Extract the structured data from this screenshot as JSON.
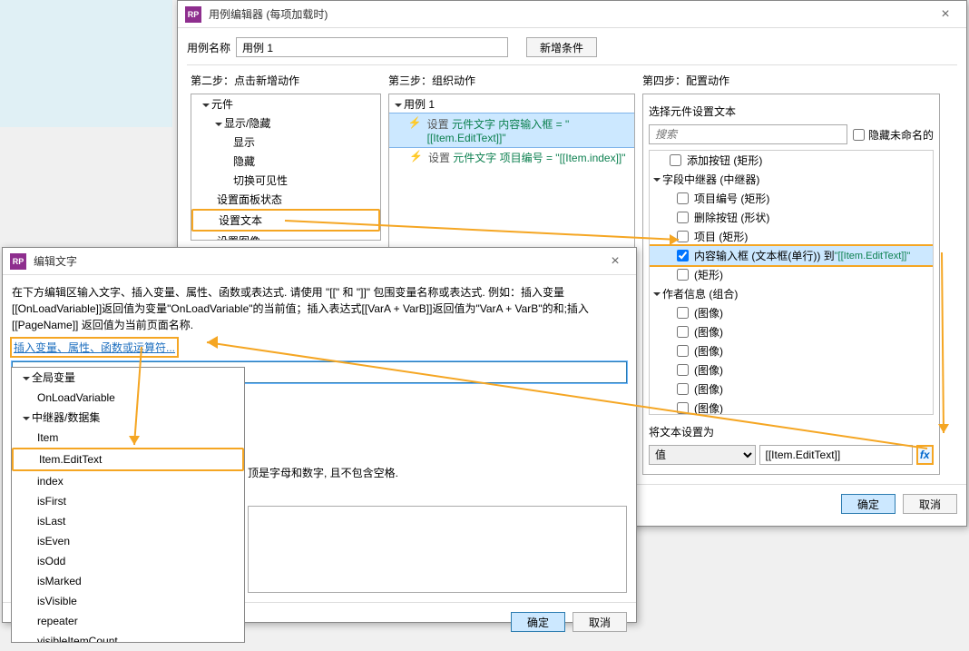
{
  "bgHint": "",
  "caseEditor": {
    "title": "用例编辑器 (每项加载时)",
    "caseNameLabel": "用例名称",
    "caseNameValue": "用例 1",
    "addConditionBtn": "新增条件",
    "step2Title": "第二步：点击新增动作",
    "step3Title": "第三步：组织动作",
    "step4Title": "第四步：配置动作",
    "actionsTree": {
      "g0": "元件",
      "g0_0": "显示/隐藏",
      "g0_0_0": "显示",
      "g0_0_1": "隐藏",
      "g0_0_2": "切换可见性",
      "g0_1": "设置面板状态",
      "g0_2": "设置文本",
      "g0_3": "设置图像"
    },
    "step3": {
      "caseHead": "用例 1",
      "a1_prefix": "设置 ",
      "a1_link": "元件文字 内容输入框 = \"[[Item.EditText]]\"",
      "a2_prefix": "设置 ",
      "a2_link": "元件文字 项目编号 = \"[[Item.index]]\""
    },
    "step4": {
      "selectHead": "选择元件设置文本",
      "searchPlaceholder": "搜索",
      "hideUnnamed": "隐藏未命名的",
      "items": {
        "addBtn": "添加按钮 (矩形)",
        "repeater": "字段中继器 (中继器)",
        "field0": "项目编号 (矩形)",
        "field1": "删除按钮 (形状)",
        "field2": "项目 (矩形)",
        "field3_a": "内容输入框 (文本框(单行)) 到 ",
        "field3_b": "\"[[Item.EditText]]\"",
        "field4": "(矩形)",
        "authorGroup": "作者信息 (组合)",
        "img": "(图像)"
      },
      "setTextAs": "将文本设置为",
      "setTextMode": "值",
      "setTextValue": "[[Item.EditText]]",
      "fxLabel": "fx"
    },
    "okBtn": "确定",
    "cancelBtn": "取消"
  },
  "editText": {
    "title": "编辑文字",
    "instructions": "在下方编辑区输入文字、插入变量、属性、函数或表达式. 请使用 \"[[\" 和 \"]]\" 包围变量名称或表达式. 例如：插入变量 [[OnLoadVariable]]返回值为变量\"OnLoadVariable\"的当前值；插入表达式[[VarA + VarB]]返回值为\"VarA + VarB\"的和;插入 [[PageName]] 返回值为当前页面名称.",
    "insertLink": "插入变量、属性、函数或运算符...",
    "inputValue": "",
    "varListLabel": "顶是字母和数字, 且不包含空格.",
    "globalsHead": "全局变量",
    "global0": "OnLoadVariable",
    "repeaterHead": "中继器/数据集",
    "r0": "Item",
    "r1": "Item.EditText",
    "r2": "index",
    "r3": "isFirst",
    "r4": "isLast",
    "r5": "isEven",
    "r6": "isOdd",
    "r7": "isMarked",
    "r8": "isVisible",
    "r9": "repeater",
    "r10": "visibleItemCount",
    "okBtn": "确定",
    "cancelBtn": "取消"
  }
}
